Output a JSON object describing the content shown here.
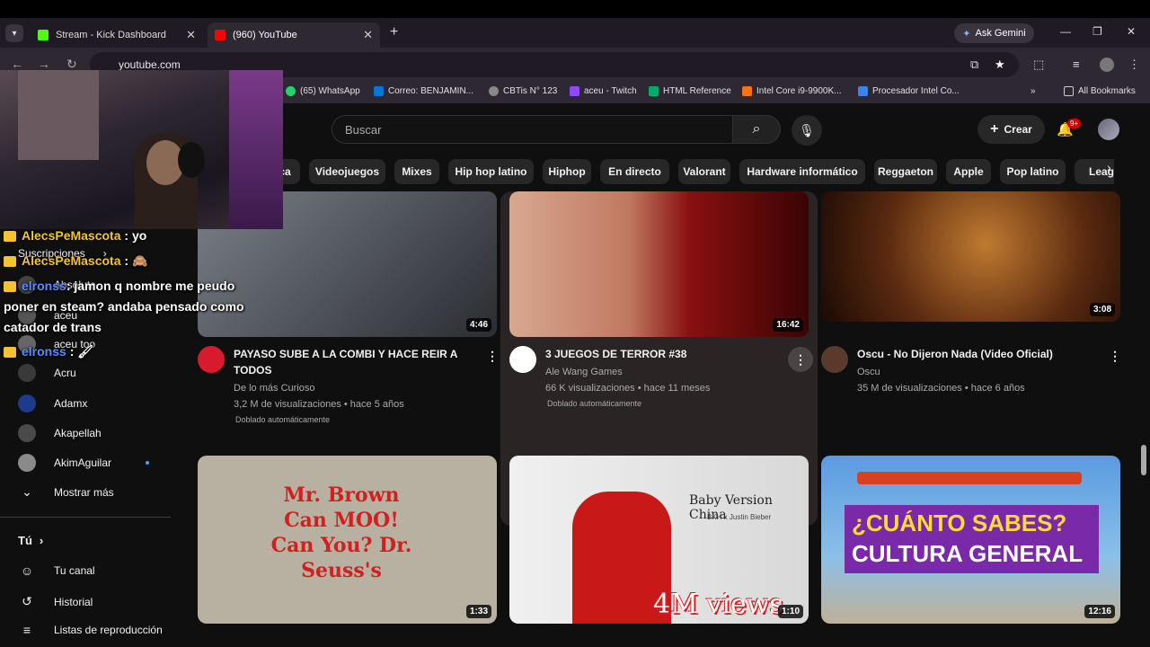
{
  "browser": {
    "tabs": [
      {
        "title": "Stream - Kick Dashboard",
        "favicon_color": "#53fc18"
      },
      {
        "title": "(960) YouTube",
        "favicon_color": "#ff0000"
      }
    ],
    "gemini_label": "Ask Gemini",
    "url": "youtube.com",
    "bookmarks": [
      {
        "label": "(65) WhatsApp",
        "color": "#25d366"
      },
      {
        "label": "Correo: BENJAMIN...",
        "color": "#0078d4"
      },
      {
        "label": "CBTis N° 123",
        "color": "#888888"
      },
      {
        "label": "aceu - Twitch",
        "color": "#9146ff"
      },
      {
        "label": "HTML Reference",
        "color": "#04aa6d"
      },
      {
        "label": "Intel Core i9-9900K...",
        "color": "#f97316"
      },
      {
        "label": "Procesador Intel Co...",
        "color": "#3b82f6"
      }
    ],
    "all_bookmarks": "All Bookmarks"
  },
  "youtube": {
    "search_placeholder": "Buscar",
    "create_label": "Crear",
    "notif_badge": "9+",
    "chips": [
      "ca",
      "Videojuegos",
      "Mixes",
      "Hip hop latino",
      "Hiphop",
      "En directo",
      "Valorant",
      "Hardware informático",
      "Reggaeton",
      "Apple",
      "Pop latino",
      "Leag"
    ],
    "sidebar": {
      "subs_header": "Suscripciones",
      "subs": [
        {
          "name": "Absolute",
          "color": "#444444"
        },
        {
          "name": "aceu",
          "color": "#555555"
        },
        {
          "name": "aceu too",
          "color": "#666666"
        },
        {
          "name": "Acru",
          "color": "#3a3a3a"
        },
        {
          "name": "Adamx",
          "color": "#1e3a8a"
        },
        {
          "name": "Akapellah",
          "color": "#4a4a4a"
        },
        {
          "name": "AkimAguilar",
          "color": "#8a8a8a"
        }
      ],
      "show_more": "Mostrar más",
      "you_header": "Tú",
      "you_items": [
        "Tu canal",
        "Historial",
        "Listas de reproducción"
      ]
    },
    "videos": [
      {
        "title": "PAYASO SUBE A LA COMBI Y HACE REIR A TODOS",
        "channel": "De lo más Curioso",
        "meta": "3,2 M de visualizaciones • hace 5 años",
        "dub": "Doblado automáticamente",
        "duration": "4:46",
        "thumb_color": "#6a6f74",
        "av_color": "#d81b2c",
        "av_label": "De lo+ Curioso"
      },
      {
        "title": "3 JUEGOS DE TERROR #38",
        "channel": "Ale Wang Games",
        "meta": "66 K visualizaciones • hace 11 meses",
        "dub": "Doblado automáticamente",
        "duration": "16:42",
        "thumb_color": "#7a1010",
        "av_color": "#ffffff"
      },
      {
        "title": "Oscu - No Dijeron Nada (Video Oficial)",
        "channel": "Oscu",
        "meta": "35 M de visualizaciones • hace 6 años",
        "duration": "3:08",
        "thumb_color": "#5a2a10",
        "av_color": "#5a3a2a"
      },
      {
        "duration": "1:33",
        "thumb_color": "#b8b0a0",
        "thumb_text": "Mr. Brown Can MOO! Can You? Dr. Seuss's"
      },
      {
        "duration": "1:10",
        "thumb_color": "#e8e8e8",
        "thumb_text": "Baby Version China",
        "thumb_sub": "BKH x Justin Bieber",
        "thumb_big": "4M views"
      },
      {
        "duration": "12:16",
        "thumb_color": "#4a8ad0",
        "thumb_text": "¿CUÁNTO SABES?",
        "thumb_sub": "CULTURA GENERAL"
      }
    ]
  },
  "overlay_chat": [
    {
      "user": "AlecsPeMascota",
      "msg": ": yo",
      "user_color": "#f4c430"
    },
    {
      "user": "AlecsPeMascota",
      "msg": ":",
      "user_color": "#f4c430"
    },
    {
      "user": "elronss",
      "msg": ": jamon q nombre me peudo poner en steam? andaba pensado como catador de trans",
      "user_color": "#5a8cff"
    },
    {
      "user": "elronss",
      "msg": ":",
      "user_color": "#5a8cff"
    }
  ]
}
